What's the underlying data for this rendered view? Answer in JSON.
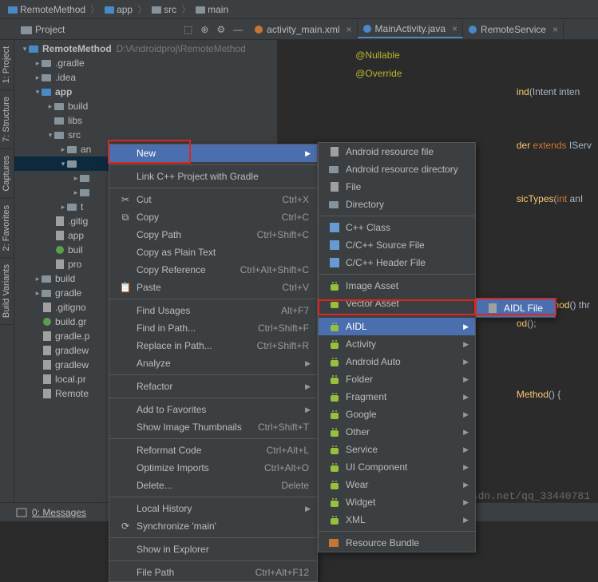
{
  "breadcrumbs": [
    "RemoteMethod",
    "app",
    "src",
    "main"
  ],
  "sidebar_tabs": [
    "1: Project",
    "7: Structure",
    "Captures",
    "2: Favorites",
    "Build Variants"
  ],
  "project_panel_label": "Project",
  "tabs": [
    {
      "icon": "xml",
      "label": "activity_main.xml",
      "active": false
    },
    {
      "icon": "java",
      "label": "MainActivity.java",
      "active": true
    },
    {
      "icon": "java",
      "label": "RemoteService"
    }
  ],
  "tree": [
    {
      "d": 0,
      "a": "v",
      "i": "mod",
      "t": "RemoteMethod",
      "suf": "D:\\Androidproj\\RemoteMethod",
      "bold": true
    },
    {
      "d": 1,
      "a": ">",
      "i": "fold",
      "t": ".gradle"
    },
    {
      "d": 1,
      "a": ">",
      "i": "fold",
      "t": ".idea"
    },
    {
      "d": 1,
      "a": "v",
      "i": "mod",
      "t": "app",
      "bold": true
    },
    {
      "d": 2,
      "a": ">",
      "i": "fold",
      "t": "build"
    },
    {
      "d": 2,
      "a": "",
      "i": "fold",
      "t": "libs"
    },
    {
      "d": 2,
      "a": "v",
      "i": "fold",
      "t": "src"
    },
    {
      "d": 3,
      "a": ">",
      "i": "fold",
      "t": "an"
    },
    {
      "d": 3,
      "a": "v",
      "i": "fold",
      "t": "",
      "sel": true
    },
    {
      "d": 4,
      "a": ">",
      "i": "fold",
      "t": ""
    },
    {
      "d": 4,
      "a": ">",
      "i": "fold",
      "t": ""
    },
    {
      "d": 3,
      "a": ">",
      "i": "fold",
      "t": "t"
    },
    {
      "d": 2,
      "a": "",
      "i": "file",
      "t": ".gitig"
    },
    {
      "d": 2,
      "a": "",
      "i": "file",
      "t": "app"
    },
    {
      "d": 2,
      "a": "",
      "i": "gradle",
      "t": "buil"
    },
    {
      "d": 2,
      "a": "",
      "i": "file",
      "t": "pro"
    },
    {
      "d": 1,
      "a": ">",
      "i": "fold",
      "t": "build"
    },
    {
      "d": 1,
      "a": ">",
      "i": "fold",
      "t": "gradle"
    },
    {
      "d": 1,
      "a": "",
      "i": "file",
      "t": ".gitigno"
    },
    {
      "d": 1,
      "a": "",
      "i": "gradle",
      "t": "build.gr"
    },
    {
      "d": 1,
      "a": "",
      "i": "file",
      "t": "gradle.p"
    },
    {
      "d": 1,
      "a": "",
      "i": "file",
      "t": "gradlew"
    },
    {
      "d": 1,
      "a": "",
      "i": "file",
      "t": "gradlew"
    },
    {
      "d": 1,
      "a": "",
      "i": "file",
      "t": "local.pr"
    },
    {
      "d": 1,
      "a": "",
      "i": "file",
      "t": "Remote"
    }
  ],
  "code_lines": [
    {
      "pre": "",
      "ann": "@Nullable"
    },
    {
      "pre": "",
      "ann": "@Override"
    },
    {
      "frag": [
        "ind",
        "(",
        "Intent",
        " inten"
      ]
    },
    {
      "blank": true
    },
    {
      "blank": true
    },
    {
      "frag": [
        "der ",
        "extends",
        " IServ"
      ]
    },
    {
      "blank": true
    },
    {
      "blank": true
    },
    {
      "frag": [
        "sicTypes",
        "(",
        "int",
        " anI"
      ]
    },
    {
      "blank": true
    },
    {
      "blank": true
    },
    {
      "blank": true
    },
    {
      "blank": true
    },
    {
      "blank": true
    },
    {
      "frag": [
        "moteMethod",
        "() ",
        "thr"
      ]
    },
    {
      "frag": [
        "od",
        "();"
      ]
    },
    {
      "blank": true
    },
    {
      "blank": true
    },
    {
      "blank": true
    },
    {
      "frag": [
        "Method",
        "() {"
      ]
    }
  ],
  "ctx1": [
    {
      "t": "New",
      "sub": true,
      "sel": true
    },
    {
      "sep": true
    },
    {
      "t": "Link C++ Project with Gradle"
    },
    {
      "sep": true
    },
    {
      "i": "cut",
      "t": "Cut",
      "k": "Ctrl+X"
    },
    {
      "i": "copy",
      "t": "Copy",
      "k": "Ctrl+C"
    },
    {
      "t": "Copy Path",
      "k": "Ctrl+Shift+C"
    },
    {
      "t": "Copy as Plain Text"
    },
    {
      "t": "Copy Reference",
      "k": "Ctrl+Alt+Shift+C"
    },
    {
      "i": "paste",
      "t": "Paste",
      "k": "Ctrl+V"
    },
    {
      "sep": true
    },
    {
      "t": "Find Usages",
      "k": "Alt+F7"
    },
    {
      "t": "Find in Path...",
      "k": "Ctrl+Shift+F"
    },
    {
      "t": "Replace in Path...",
      "k": "Ctrl+Shift+R"
    },
    {
      "t": "Analyze",
      "sub": true
    },
    {
      "sep": true
    },
    {
      "t": "Refactor",
      "sub": true
    },
    {
      "sep": true
    },
    {
      "t": "Add to Favorites",
      "sub": true
    },
    {
      "t": "Show Image Thumbnails",
      "k": "Ctrl+Shift+T"
    },
    {
      "sep": true
    },
    {
      "t": "Reformat Code",
      "k": "Ctrl+Alt+L"
    },
    {
      "t": "Optimize Imports",
      "k": "Ctrl+Alt+O"
    },
    {
      "t": "Delete...",
      "k": "Delete"
    },
    {
      "sep": true
    },
    {
      "t": "Local History",
      "sub": true
    },
    {
      "i": "sync",
      "t": "Synchronize 'main'"
    },
    {
      "sep": true
    },
    {
      "t": "Show in Explorer"
    },
    {
      "sep": true
    },
    {
      "t": "File Path",
      "k": "Ctrl+Alt+F12"
    }
  ],
  "ctx2": [
    {
      "i": "file",
      "t": "Android resource file"
    },
    {
      "i": "fold",
      "t": "Android resource directory"
    },
    {
      "i": "file",
      "t": "File"
    },
    {
      "i": "fold",
      "t": "Directory"
    },
    {
      "sep": true
    },
    {
      "i": "cpp",
      "t": "C++ Class"
    },
    {
      "i": "cpp",
      "t": "C/C++ Source File"
    },
    {
      "i": "cpp",
      "t": "C/C++ Header File"
    },
    {
      "sep": true
    },
    {
      "i": "droid",
      "t": "Image Asset"
    },
    {
      "i": "droid",
      "t": "Vector Asset"
    },
    {
      "sep": true
    },
    {
      "i": "droid",
      "t": "AIDL",
      "sub": true,
      "sel": true
    },
    {
      "i": "droid",
      "t": "Activity",
      "sub": true
    },
    {
      "i": "droid",
      "t": "Android Auto",
      "sub": true
    },
    {
      "i": "droid",
      "t": "Folder",
      "sub": true
    },
    {
      "i": "droid",
      "t": "Fragment",
      "sub": true
    },
    {
      "i": "droid",
      "t": "Google",
      "sub": true
    },
    {
      "i": "droid",
      "t": "Other",
      "sub": true
    },
    {
      "i": "droid",
      "t": "Service",
      "sub": true
    },
    {
      "i": "droid",
      "t": "UI Component",
      "sub": true
    },
    {
      "i": "droid",
      "t": "Wear",
      "sub": true
    },
    {
      "i": "droid",
      "t": "Widget",
      "sub": true
    },
    {
      "i": "droid",
      "t": "XML",
      "sub": true
    },
    {
      "sep": true
    },
    {
      "i": "res",
      "t": "Resource Bundle"
    }
  ],
  "ctx3": [
    {
      "i": "file",
      "t": "AIDL File",
      "sel": true
    }
  ],
  "bottombar": {
    "messages": "0: Messages"
  },
  "watermark": "http://blog.csdn.net/qq_33440781"
}
